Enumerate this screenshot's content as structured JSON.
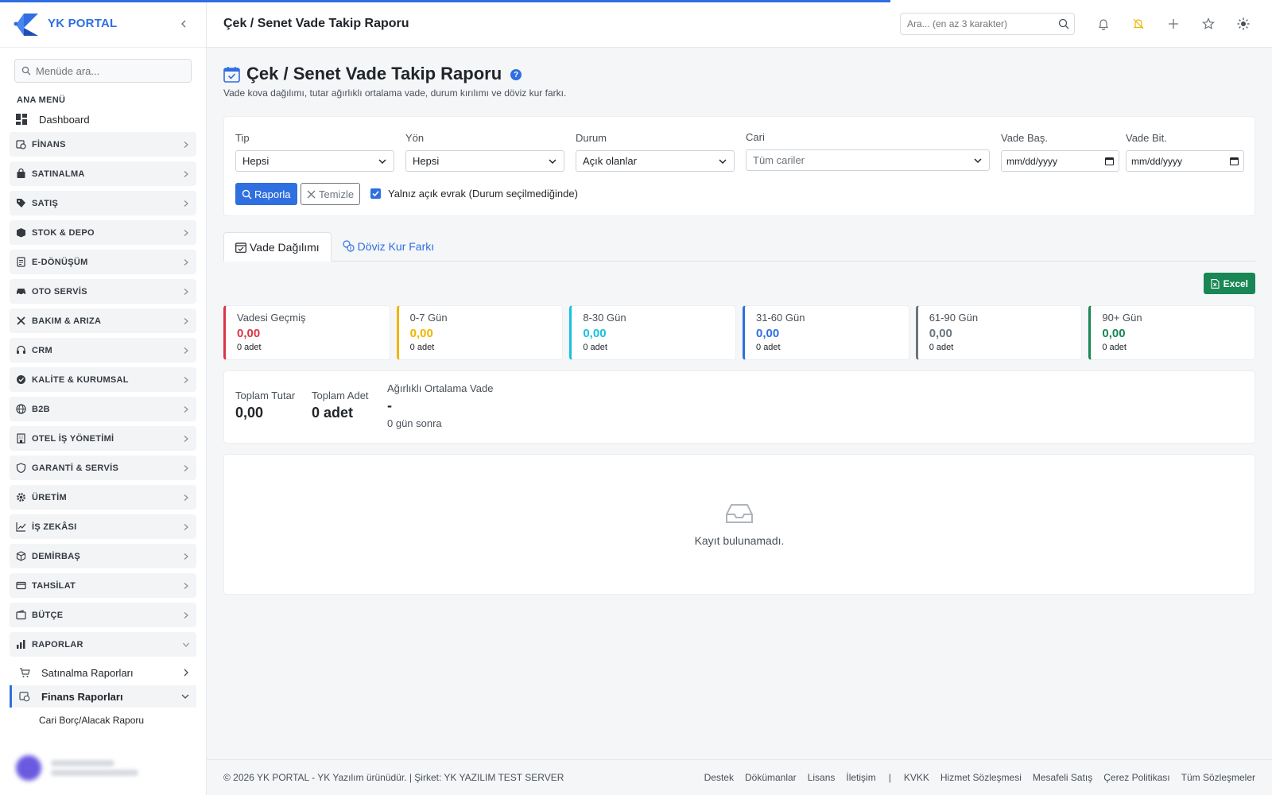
{
  "brand": {
    "name": "YK PORTAL"
  },
  "sidebar": {
    "search_placeholder": "Menüde ara...",
    "heading": "ANA MENÜ",
    "dashboard_label": "Dashboard",
    "groups": [
      {
        "label": "FİNANS",
        "icon": "finance-icon"
      },
      {
        "label": "SATINALMA",
        "icon": "bag-icon"
      },
      {
        "label": "SATIŞ",
        "icon": "tag-icon"
      },
      {
        "label": "STOK & DEPO",
        "icon": "box-icon"
      },
      {
        "label": "E-DÖNÜŞÜM",
        "icon": "document-icon"
      },
      {
        "label": "OTO SERVİS",
        "icon": "car-icon"
      },
      {
        "label": "BAKIM & ARIZA",
        "icon": "tools-icon"
      },
      {
        "label": "CRM",
        "icon": "headset-icon"
      },
      {
        "label": "KALİTE & KURUMSAL",
        "icon": "badge-icon"
      },
      {
        "label": "B2B",
        "icon": "globe-icon"
      },
      {
        "label": "OTEL İŞ YÖNETİMİ",
        "icon": "building-icon"
      },
      {
        "label": "GARANTİ & SERVİS",
        "icon": "shield-icon"
      },
      {
        "label": "ÜRETİM",
        "icon": "gear-icon"
      },
      {
        "label": "İŞ ZEKÂSI",
        "icon": "trend-icon"
      },
      {
        "label": "DEMİRBAŞ",
        "icon": "cube-icon"
      },
      {
        "label": "TAHSİLAT",
        "icon": "card-icon"
      },
      {
        "label": "BÜTÇE",
        "icon": "wallet-icon"
      },
      {
        "label": "RAPORLAR",
        "icon": "bar-chart-icon"
      }
    ],
    "reports_sub": [
      {
        "label": "Satınalma Raporları",
        "icon": "cart-icon"
      },
      {
        "label": "Finans Raporları",
        "icon": "finance-icon"
      }
    ],
    "finance_leaf": "Cari Borç/Alacak Raporu"
  },
  "header": {
    "title": "Çek / Senet Vade Takip Raporu",
    "search_placeholder": "Ara... (en az 3 karakter)"
  },
  "page": {
    "title": "Çek / Senet Vade Takip Raporu",
    "help": "?",
    "subtitle": "Vade kova dağılımı, tutar ağırlıklı ortalama vade, durum kırılımı ve döviz kur farkı."
  },
  "filters": {
    "tip": {
      "label": "Tip",
      "value": "Hepsi"
    },
    "yon": {
      "label": "Yön",
      "value": "Hepsi"
    },
    "durum": {
      "label": "Durum",
      "value": "Açık olanlar"
    },
    "cari": {
      "label": "Cari",
      "value": "Tüm cariler"
    },
    "vade_bas": {
      "label": "Vade Baş.",
      "value": "mm/dd/yyyy"
    },
    "vade_bit": {
      "label": "Vade Bit.",
      "value": "mm/dd/yyyy"
    },
    "report_button": "Raporla",
    "clear_button": "Temizle",
    "open_only_label": "Yalnız açık evrak (Durum seçilmediğinde)",
    "open_only_checked": true
  },
  "tabs": [
    {
      "label": "Vade Dağılımı",
      "active": true
    },
    {
      "label": "Döviz Kur Farkı",
      "active": false
    }
  ],
  "excel_button": "Excel",
  "buckets": [
    {
      "name": "Vadesi Geçmiş",
      "value": "0,00",
      "count": "0 adet",
      "color": "#dc3545"
    },
    {
      "name": "0-7 Gün",
      "value": "0,00",
      "count": "0 adet",
      "color": "#f0b400"
    },
    {
      "name": "8-30 Gün",
      "value": "0,00",
      "count": "0 adet",
      "color": "#17c1e0"
    },
    {
      "name": "31-60 Gün",
      "value": "0,00",
      "count": "0 adet",
      "color": "#2f6fe0"
    },
    {
      "name": "61-90 Gün",
      "value": "0,00",
      "count": "0 adet",
      "color": "#6c757d"
    },
    {
      "name": "90+ Gün",
      "value": "0,00",
      "count": "0 adet",
      "color": "#198754"
    }
  ],
  "totals": {
    "amount_label": "Toplam Tutar",
    "amount_value": "0,00",
    "count_label": "Toplam Adet",
    "count_value": "0 adet",
    "avg_label": "Ağırlıklı Ortalama Vade",
    "avg_value": "-",
    "avg_sub": "0 gün sonra"
  },
  "empty": {
    "text": "Kayıt bulunamadı."
  },
  "footer": {
    "copyright": "© 2026 YK PORTAL - YK Yazılım ürünüdür. | Şirket: YK YAZILIM TEST SERVER",
    "links": [
      "Destek",
      "Dökümanlar",
      "Lisans",
      "İletişim"
    ],
    "separator": "|",
    "legal_links": [
      "KVKK",
      "Hizmet Sözleşmesi",
      "Mesafeli Satış",
      "Çerez Politikası",
      "Tüm Sözleşmeler"
    ]
  },
  "colors": {
    "primary": "#2f6fe0",
    "success": "#198754",
    "danger": "#dc3545",
    "warning": "#f0b400",
    "info": "#17c1e0",
    "secondary": "#6c757d"
  }
}
